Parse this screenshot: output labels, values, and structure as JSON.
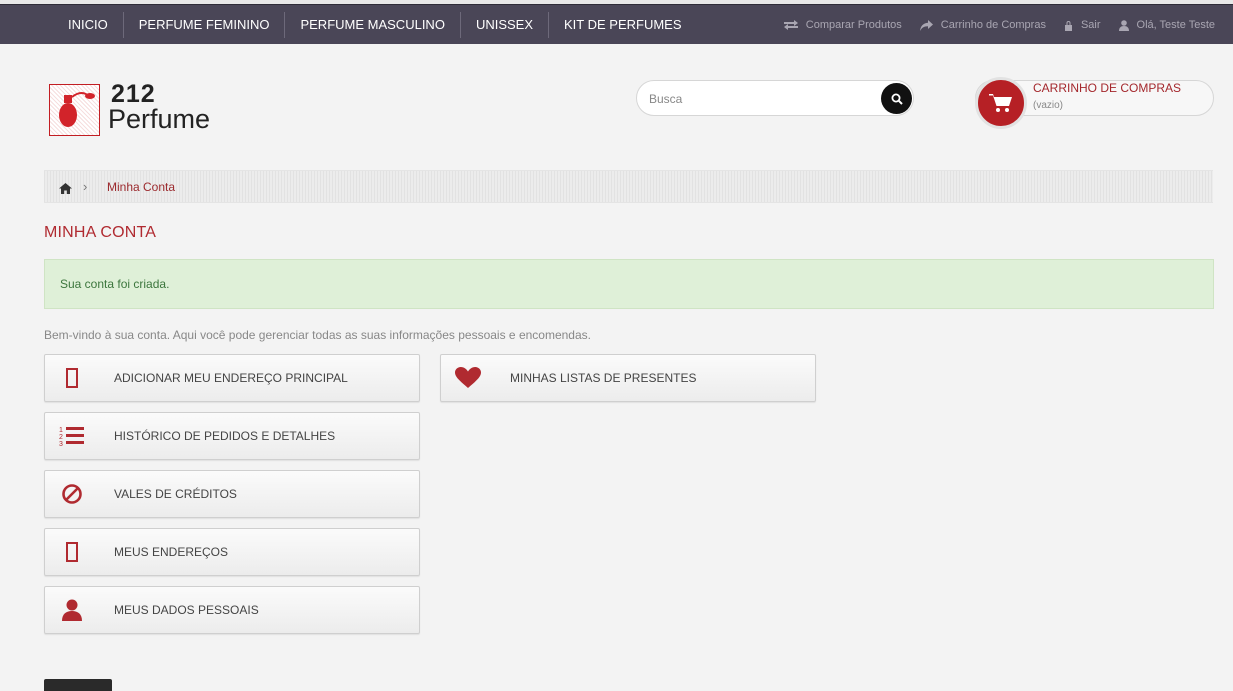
{
  "colors": {
    "accent": "#b02a30",
    "topbar": "#4a4657",
    "success_bg": "#dff0d8",
    "success_text": "#3c763d"
  },
  "topnav": {
    "items": [
      {
        "label": "INICIO"
      },
      {
        "label": "PERFUME FEMININO"
      },
      {
        "label": "PERFUME MASCULINO"
      },
      {
        "label": "UNISSEX"
      },
      {
        "label": "KIT DE PERFUMES"
      }
    ]
  },
  "user_links": {
    "compare": {
      "label": "Comparar Produtos",
      "icon": "compare-arrows-icon"
    },
    "cart": {
      "label": "Carrinho de Compras",
      "icon": "share-arrow-icon"
    },
    "logout": {
      "label": "Sair",
      "icon": "lock-icon"
    },
    "greeting": {
      "label": "Olá, Teste Teste",
      "icon": "user-icon"
    }
  },
  "logo": {
    "line1": "212",
    "line2": "Perfume"
  },
  "search": {
    "placeholder": "Busca",
    "value": ""
  },
  "cart_widget": {
    "title": "CARRINHO DE COMPRAS",
    "status": "(vazio)"
  },
  "breadcrumb": {
    "current": "Minha Conta",
    "separator": "›"
  },
  "page": {
    "title": "MINHA CONTA",
    "alert": "Sua conta foi criada.",
    "intro": "Bem-vindo à sua conta. Aqui você pode gerenciar todas as suas informações pessoais e encomendas."
  },
  "account_buttons": [
    {
      "label": "ADICIONAR MEU ENDEREÇO PRINCIPAL",
      "icon": "building-icon"
    },
    {
      "label": "HISTÓRICO DE PEDIDOS E DETALHES",
      "icon": "ordered-list-icon"
    },
    {
      "label": "VALES DE CRÉDITOS",
      "icon": "ban-icon"
    },
    {
      "label": "MEUS ENDEREÇOS",
      "icon": "building-icon"
    },
    {
      "label": "MEUS DADOS PESSOAIS",
      "icon": "user-icon"
    },
    {
      "label": "MINHAS LISTAS DE PRESENTES",
      "icon": "heart-icon"
    }
  ]
}
